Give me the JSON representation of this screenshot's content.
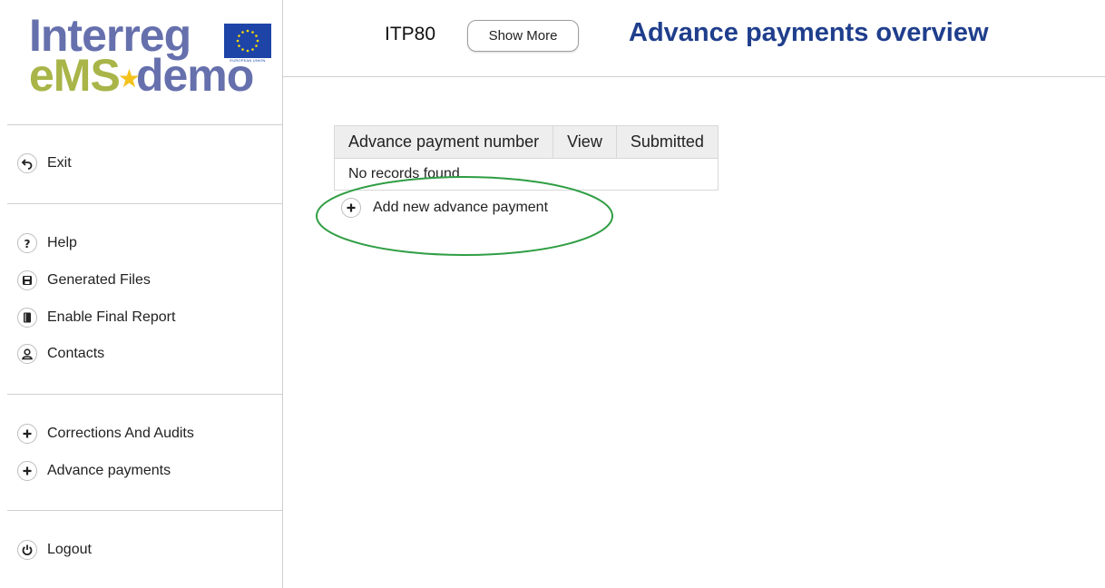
{
  "logo": {
    "line1": "Interreg",
    "ems": "eMS",
    "star": "★",
    "demo": "demo",
    "eu_caption": "EUROPEAN UNION"
  },
  "sidebar": {
    "exit_label": "Exit",
    "help_label": "Help",
    "generated_files_label": "Generated Files",
    "enable_final_report_label": "Enable Final Report",
    "contacts_label": "Contacts",
    "corrections_label": "Corrections And Audits",
    "advance_payments_label": "Advance payments",
    "logout_label": "Logout"
  },
  "header": {
    "project_code": "ITP80",
    "show_more_label": "Show More",
    "title": "Advance payments overview"
  },
  "table": {
    "columns": [
      "Advance payment number",
      "View",
      "Submitted"
    ],
    "empty_message": "No records found."
  },
  "actions": {
    "add_label": "Add new advance payment"
  },
  "colors": {
    "title": "#1f3e8c",
    "logo_blue": "#6670ad",
    "logo_green": "#a9b548",
    "highlight": "#2f9e44",
    "eu_blue": "#1e44a8"
  }
}
